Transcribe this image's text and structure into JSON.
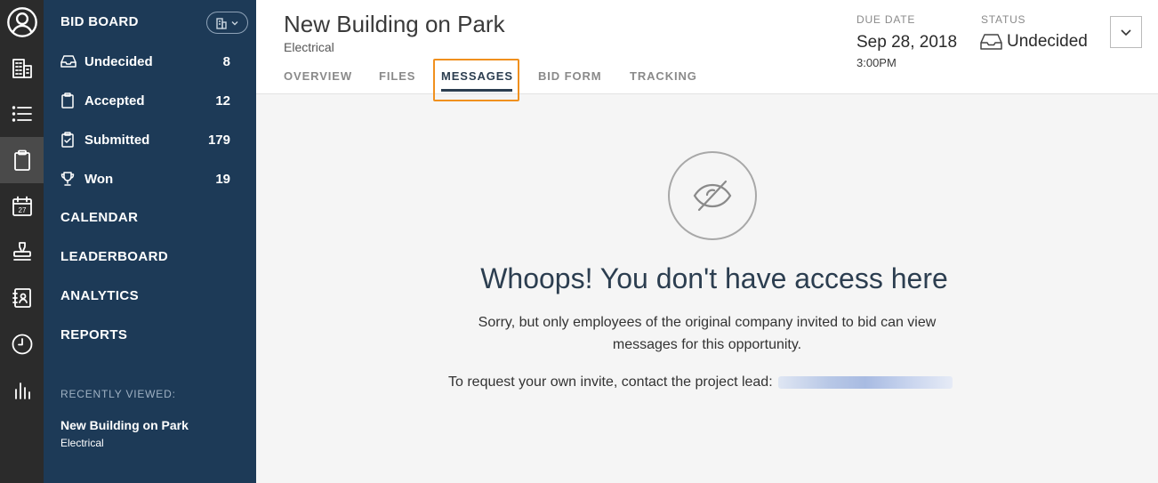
{
  "rail": {
    "items": [
      {
        "name": "profile-icon"
      },
      {
        "name": "building-icon"
      },
      {
        "name": "list-icon"
      },
      {
        "name": "clipboard-icon",
        "active": true
      },
      {
        "name": "calendar-icon",
        "day": "27"
      },
      {
        "name": "stamp-icon"
      },
      {
        "name": "contacts-book-icon"
      },
      {
        "name": "clock-icon"
      },
      {
        "name": "bar-chart-icon"
      }
    ]
  },
  "sidebar": {
    "title": "BID BOARD",
    "rows": [
      {
        "label": "Undecided",
        "count": "8",
        "icon": "inbox-icon"
      },
      {
        "label": "Accepted",
        "count": "12",
        "icon": "clipboard-icon"
      },
      {
        "label": "Submitted",
        "count": "179",
        "icon": "clipboard-check-icon"
      },
      {
        "label": "Won",
        "count": "19",
        "icon": "trophy-icon"
      }
    ],
    "links": [
      "CALENDAR",
      "LEADERBOARD",
      "ANALYTICS",
      "REPORTS"
    ],
    "recent_heading": "RECENTLY VIEWED:",
    "recent_title": "New Building on Park",
    "recent_sub": "Electrical"
  },
  "header": {
    "title": "New Building on Park",
    "subtitle": "Electrical",
    "tabs": [
      "OVERVIEW",
      "FILES",
      "MESSAGES",
      "BID FORM",
      "TRACKING"
    ],
    "active_tab": "MESSAGES",
    "due_label": "DUE DATE",
    "due_date": "Sep 28, 2018",
    "due_time": "3:00PM",
    "status_label": "STATUS",
    "status_value": "Undecided"
  },
  "main": {
    "heading": "Whoops! You don't have access here",
    "body": "Sorry, but only employees of the original company invited to bid can view messages for this opportunity.",
    "request_text": "To request your own invite, contact the project lead:"
  },
  "colors": {
    "rail": "#2b2b2b",
    "sidebar": "#1d3a57",
    "highlight": "#f0901e",
    "heading": "#2c3e50"
  }
}
